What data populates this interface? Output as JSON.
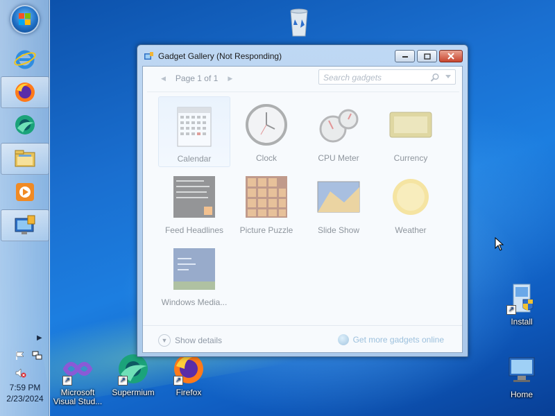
{
  "taskbar": {
    "clock_time": "7:59 PM",
    "clock_date": "2/23/2024"
  },
  "desktop": {
    "icons": [
      {
        "label": "Recycle Bin",
        "icon": "recycle-bin-icon"
      },
      {
        "label": "Install",
        "icon": "install-icon"
      },
      {
        "label": "Home",
        "icon": "home-computer-icon"
      },
      {
        "label": "Microsoft Visual Stud...",
        "icon": "visual-studio-icon"
      },
      {
        "label": "Supermium",
        "icon": "supermium-icon"
      },
      {
        "label": "Firefox",
        "icon": "firefox-icon"
      }
    ]
  },
  "window": {
    "title": "Gadget Gallery (Not Responding)",
    "pager": "Page 1 of 1",
    "search_placeholder": "Search gadgets",
    "gadgets": [
      {
        "label": "Calendar",
        "icon": "calendar-gadget-icon"
      },
      {
        "label": "Clock",
        "icon": "clock-gadget-icon"
      },
      {
        "label": "CPU Meter",
        "icon": "cpu-meter-gadget-icon"
      },
      {
        "label": "Currency",
        "icon": "currency-gadget-icon"
      },
      {
        "label": "Feed Headlines",
        "icon": "feed-headlines-gadget-icon"
      },
      {
        "label": "Picture Puzzle",
        "icon": "picture-puzzle-gadget-icon"
      },
      {
        "label": "Slide Show",
        "icon": "slide-show-gadget-icon"
      },
      {
        "label": "Weather",
        "icon": "weather-gadget-icon"
      },
      {
        "label": "Windows Media...",
        "icon": "windows-media-gadget-icon"
      }
    ],
    "show_details": "Show details",
    "get_more": "Get more gadgets online"
  }
}
